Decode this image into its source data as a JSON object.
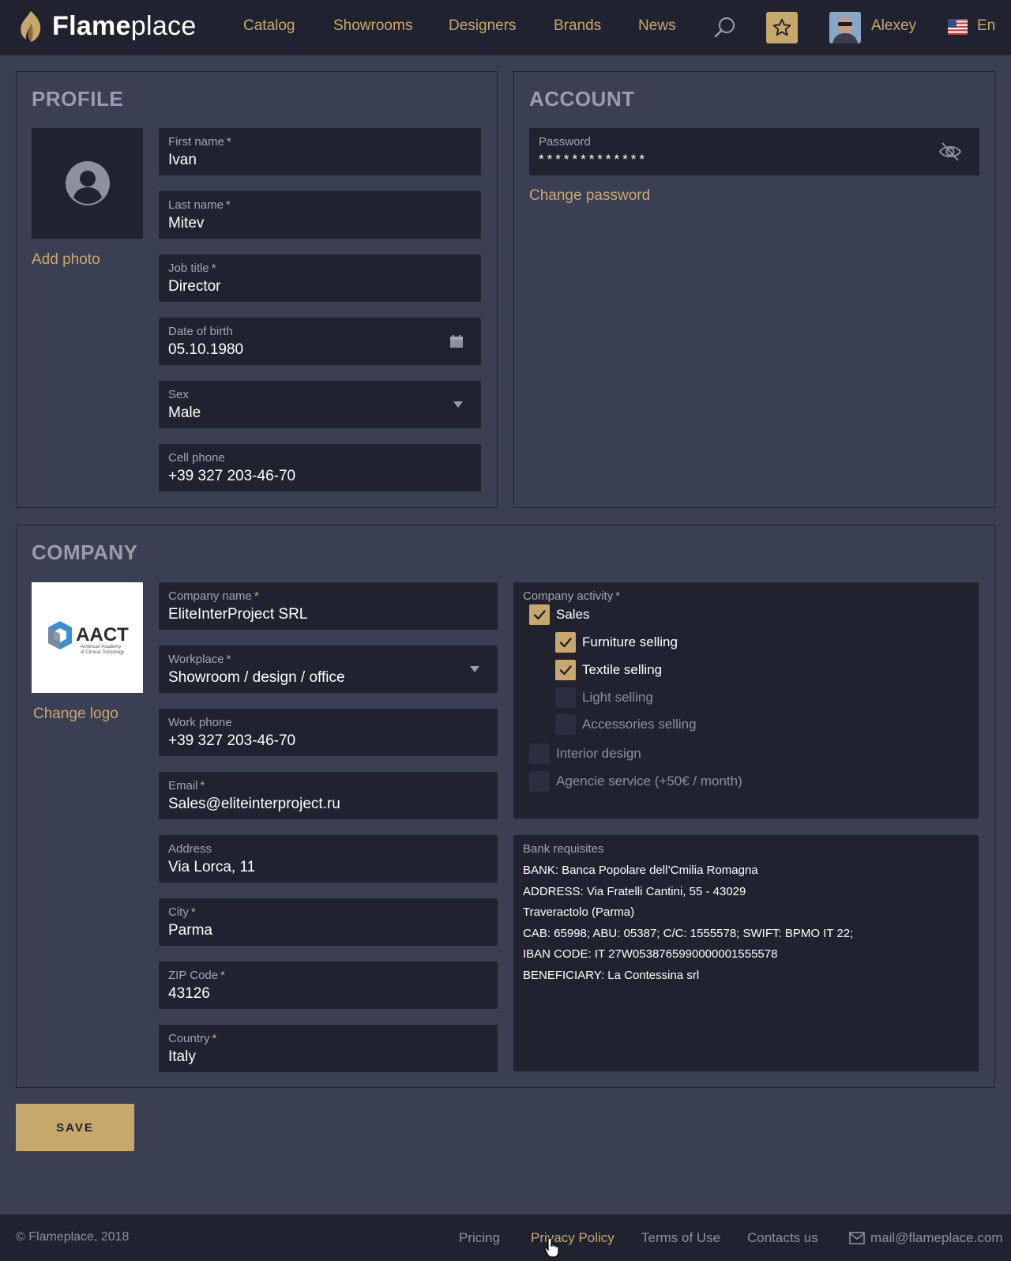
{
  "header": {
    "brand_bold": "Flame",
    "brand_light": "place",
    "nav": [
      "Catalog",
      "Showrooms",
      "Designers",
      "Brands",
      "News"
    ],
    "user_name": "Alexey",
    "language": "En",
    "icons": {
      "search": "search-icon",
      "favorites": "star-icon",
      "flag": "us-flag-icon"
    }
  },
  "profile": {
    "title": "PROFILE",
    "add_photo": "Add photo",
    "fields": {
      "first_name": {
        "label": "First name",
        "value": "Ivan"
      },
      "last_name": {
        "label": "Last name",
        "value": "Mitev"
      },
      "job_title": {
        "label": "Job title",
        "value": "Director"
      },
      "dob": {
        "label": "Date of birth",
        "value": "05.10.1980"
      },
      "sex": {
        "label": "Sex",
        "value": "Male"
      },
      "cell_phone": {
        "label": "Cell phone",
        "value": "+39 327 203-46-70"
      }
    }
  },
  "account": {
    "title": "ACCOUNT",
    "password_label": "Password",
    "password_mask": "*************",
    "change_password": "Change password"
  },
  "company": {
    "title": "COMPANY",
    "change_logo": "Change logo",
    "logo_name": "AACT",
    "logo_sub1": "American Academy",
    "logo_sub2": "of Clinical Toxicology",
    "fields": {
      "company_name": {
        "label": "Company name",
        "value": "EliteInterProject SRL"
      },
      "workplace": {
        "label": "Workplace",
        "value": "Showroom / design / office"
      },
      "work_phone": {
        "label": "Work phone",
        "value": "+39 327 203-46-70"
      },
      "email": {
        "label": "Email",
        "value": "Sales@eliteinterproject.ru"
      },
      "address": {
        "label": "Address",
        "value": "Via Lorca, 11"
      },
      "city": {
        "label": "City",
        "value": "Parma"
      },
      "zip": {
        "label": "ZIP Code",
        "value": "43126"
      },
      "country": {
        "label": "Country",
        "value": "Italy"
      }
    },
    "activity": {
      "label": "Company activity",
      "items": [
        {
          "label": "Sales",
          "checked": true
        },
        {
          "label": "Furniture selling",
          "checked": true
        },
        {
          "label": "Textile selling",
          "checked": true
        },
        {
          "label": "Light selling",
          "checked": false
        },
        {
          "label": "Accessories selling",
          "checked": false
        },
        {
          "label": "Interior design",
          "checked": false
        },
        {
          "label": "Agencie service (+50€ / month)",
          "checked": false
        }
      ]
    },
    "bank": {
      "label": "Bank requisites",
      "lines": [
        "BANK: Banca Popolare dell’Cmilia Romagna",
        "ADDRESS: Via Fratelli Cantini, 55 - 43029",
        "Traveractolo (Parma)",
        "CAB: 65998; ABU: 05387; C/C: 1555578; SWIFT: BPMO IT 22;",
        "IBAN CODE: IT 27W0538765990000001555578",
        "BENEFICIARY: La Contessina srl"
      ]
    }
  },
  "save_label": "SAVE",
  "footer": {
    "copyright": "© Flameplace, 2018",
    "links": [
      "Pricing",
      "Privacy Policy",
      "Terms of Use",
      "Contacts us"
    ],
    "email": "mail@flameplace.com"
  },
  "colors": {
    "accent": "#c7a86c",
    "background": "#3b3f53",
    "field_bg": "#20222f",
    "header_bg": "#20222f"
  }
}
